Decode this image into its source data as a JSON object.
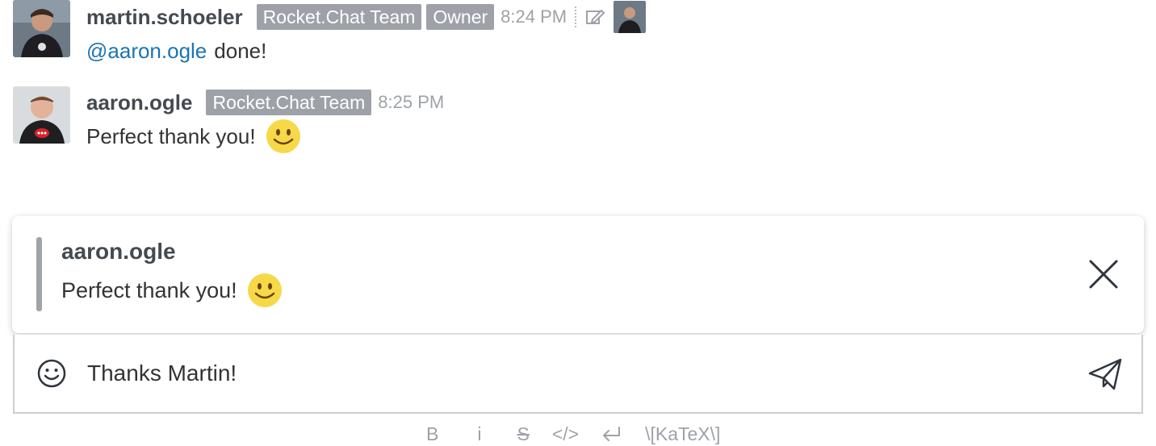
{
  "messages": [
    {
      "username": "martin.schoeler",
      "tags": [
        "Rocket.Chat Team",
        "Owner"
      ],
      "time": "8:24 PM",
      "mention": "@aaron.ogle",
      "text": "done!",
      "edited": true
    },
    {
      "username": "aaron.ogle",
      "tags": [
        "Rocket.Chat Team"
      ],
      "time": "8:25 PM",
      "text": "Perfect thank you!"
    }
  ],
  "reply": {
    "username": "aaron.ogle",
    "text": "Perfect thank you!"
  },
  "composer": {
    "value": "Thanks Martin!"
  },
  "toolbar": {
    "bold": "B",
    "italic": "i",
    "strike": "S",
    "code": "</>",
    "katex": "\\[KaTeX\\]"
  },
  "colors": {
    "tag_bg": "#9ea2a8",
    "mention": "#1d74b3",
    "emoji": "#f7d849"
  }
}
